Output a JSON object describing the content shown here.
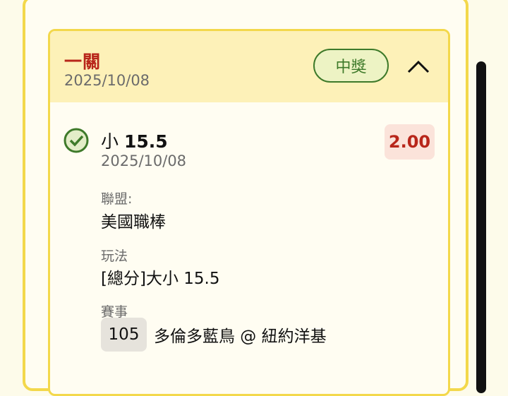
{
  "ticket": {
    "type": "一關",
    "date": "2025/10/08",
    "status": "中獎",
    "collapse_icon": "chevron-up-icon"
  },
  "bet": {
    "status_icon": "check-circle-icon",
    "selection_prefix": "小",
    "selection_line": "15.5",
    "date": "2025/10/08",
    "odds": "2.00",
    "league_label": "聯盟:",
    "league": "美國職棒",
    "play_label": "玩法",
    "play": "[總分]大小 15.5",
    "event_label": "賽事",
    "event_no": "105",
    "event_name": "多倫多藍鳥 @ 紐約洋基"
  },
  "colors": {
    "accent": "#f3d84b",
    "header_bg": "#fdf1b8",
    "win_green": "#3e7a2a",
    "odds_red": "#b8261a"
  }
}
